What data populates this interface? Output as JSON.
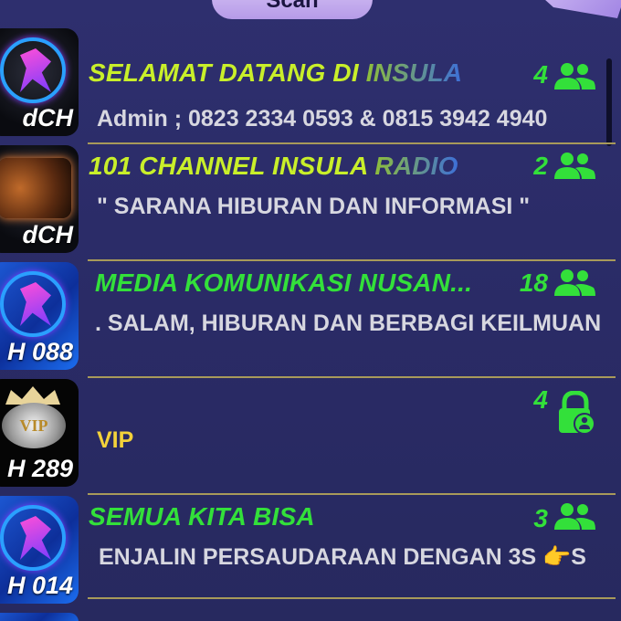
{
  "header": {
    "scan_label": "Scan"
  },
  "rooms": [
    {
      "title_main": "SELAMAT DATANG DI ",
      "title_fade": "INSULA",
      "title_color": "#c9ef2a",
      "count": "4",
      "member_icon": "people-icon",
      "subtitle": "Admin ; 0823 2334 0593 & 0815 3942 4940",
      "thumb_code": "dCH",
      "thumb_style": "neon-logo"
    },
    {
      "title_main": "101 CHANNEL INSULA ",
      "title_fade": "RADIO",
      "title_color": "#c9ef2a",
      "count": "2",
      "member_icon": "people-icon",
      "subtitle": "\" SARANA HIBURAN DAN INFORMASI \"",
      "thumb_code": "dCH",
      "thumb_style": "radio"
    },
    {
      "title_main": "MEDIA KOMUNIKASI NUSAN...",
      "title_fade": "",
      "title_color": "#33e03a",
      "count": "18",
      "member_icon": "people-icon",
      "subtitle": ". SALAM, HIBURAN DAN BERBAGI KEILMUAN",
      "thumb_code": "H 088",
      "thumb_style": "blue-logo"
    },
    {
      "title_main": "",
      "title_fade": "",
      "title_color": "#33e03a",
      "count": "4",
      "member_icon": "lock-user-icon",
      "subtitle": "VIP",
      "subtitle_color": "#f3d23a",
      "thumb_code": "H 289",
      "thumb_style": "vip"
    },
    {
      "title_main": "SEMUA KITA BISA",
      "title_fade": "",
      "title_color": "#33e03a",
      "count": "3",
      "member_icon": "people-icon",
      "subtitle": "ENJALIN PERSAUDARAAN DENGAN 3S 👉S",
      "thumb_code": "H 014",
      "thumb_style": "blue-logo"
    }
  ],
  "colors": {
    "background": "#2a2b66",
    "count_green": "#33e03a",
    "divider": "#a89a5a"
  }
}
